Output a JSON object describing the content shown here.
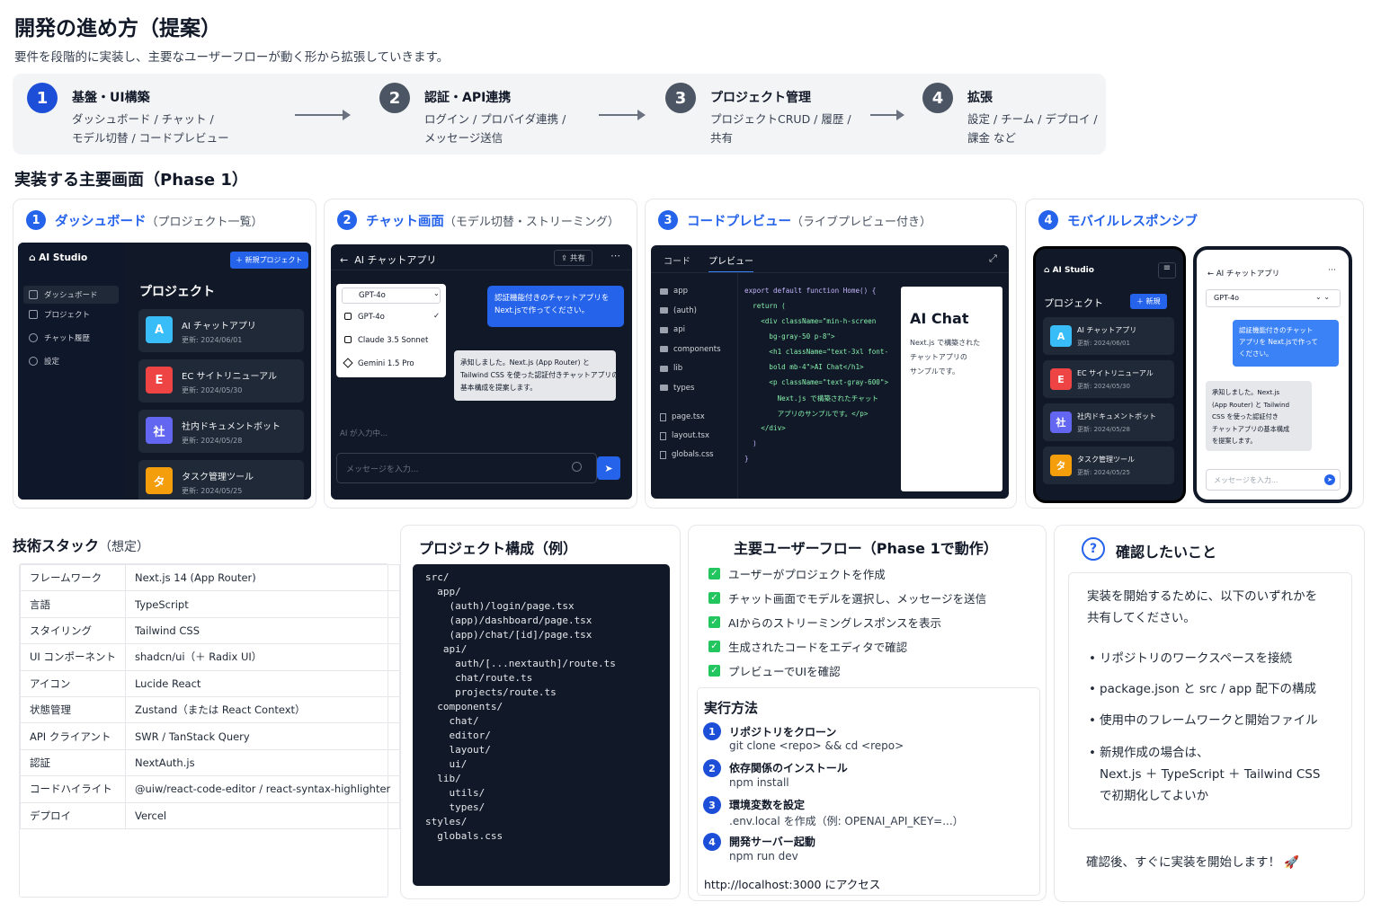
{
  "title": "開発の進め方（提案）",
  "subtitle": "要件を段階的に実装し、主要なユーザーフローが動く形から拡張していきます。",
  "steps": [
    {
      "n": "1",
      "title": "基盤・UI構築",
      "desc": "ダッシュボード / チャット /\nモデル切替 / コードプレビュー"
    },
    {
      "n": "2",
      "title": "認証・API連携",
      "desc": "ログイン / プロバイダ連携 /\nメッセージ送信"
    },
    {
      "n": "3",
      "title": "プロジェクト管理",
      "desc": "プロジェクトCRUD / 履歴 /\n共有"
    },
    {
      "n": "4",
      "title": "拡張",
      "desc": "設定 / チーム / デプロイ /\n課金 など"
    }
  ],
  "screens_heading": "実装する主要画面（Phase 1）",
  "cards": [
    {
      "n": "1",
      "title": "ダッシュボード",
      "sub": "（プロジェクト一覧）"
    },
    {
      "n": "2",
      "title": "チャット画面",
      "sub": "（モデル切替・ストリーミング）"
    },
    {
      "n": "3",
      "title": "コードプレビュー",
      "sub": "（ライブプレビュー付き）"
    },
    {
      "n": "4",
      "title": "モバイルレスポンシブ",
      "sub": ""
    }
  ],
  "dash": {
    "brand": "AI Studio",
    "new_btn": "＋ 新規プロジェクト",
    "heading": "プロジェクト",
    "nav": [
      "ダッシュボード",
      "プロジェクト",
      "チャット履歴",
      "設定"
    ],
    "projects": [
      {
        "av": "A",
        "name": "AI チャットアプリ",
        "date": "更新: 2024/06/01",
        "color": "#38bdf8"
      },
      {
        "av": "E",
        "name": "EC サイトリニューアル",
        "date": "更新: 2024/05/30",
        "color": "#ef4444"
      },
      {
        "av": "社",
        "name": "社内ドキュメントボット",
        "date": "更新: 2024/05/28",
        "color": "#6366f1"
      },
      {
        "av": "タ",
        "name": "タスク管理ツール",
        "date": "更新: 2024/05/25",
        "color": "#f59e0b"
      }
    ]
  },
  "chat": {
    "title": "AI チャットアプリ",
    "share": "共有",
    "models": [
      "GPT-4o",
      "GPT-4o",
      "Claude 3.5 Sonnet",
      "Gemini 1.5 Pro"
    ],
    "user_msg": "認証機能付きのチャットアプリを\nNext.jsで作ってください。",
    "ai_msg": "承知しました。Next.js (App Router) と\nTailwind CSS を使った認証付きチャットアプリの\n基本構成を提案します。",
    "typing": "AI が入力中...",
    "placeholder": "メッセージを入力..."
  },
  "code": {
    "tabs": [
      "コード",
      "プレビュー"
    ],
    "files": [
      "app",
      "(auth)",
      "api",
      "components",
      "lib",
      "types",
      "page.tsx",
      "layout.tsx",
      "globals.css"
    ],
    "lines": [
      "export default function Home() {",
      "  return (",
      "    <div className=\"min-h-screen",
      "      bg-gray-50 p-8\">",
      "      <h1 className=\"text-3xl font-",
      "      bold mb-4\">AI Chat</h1>",
      "      <p className=\"text-gray-600\">",
      "        Next.js で構築されたチャット",
      "        アプリのサンプルです。</p>",
      "    </div>",
      "  )",
      "}"
    ],
    "preview_title": "AI Chat",
    "preview_text": "Next.js で構築された\nチャットアプリの\nサンプルです。"
  },
  "mobile": {
    "brand": "AI Studio",
    "heading": "プロジェクト",
    "new_btn": "＋ 新規",
    "chat_title": "AI チャットアプリ",
    "model": "GPT-4o",
    "user_msg": "認証機能付きのチャット\nアプリを Next.jsで作って\nください。",
    "ai_msg": "承知しました。Next.js\n(App Router) と Tailwind\nCSS を使った認証付き\nチャットアプリの基本構成\nを提案します。",
    "placeholder": "メッセージを入力..."
  },
  "tech": {
    "heading": "技術スタック",
    "heading_sub": "（想定）",
    "rows": [
      [
        "フレームワーク",
        "Next.js 14 (App Router)"
      ],
      [
        "言語",
        "TypeScript"
      ],
      [
        "スタイリング",
        "Tailwind CSS"
      ],
      [
        "UI コンポーネント",
        "shadcn/ui（＋ Radix UI）"
      ],
      [
        "アイコン",
        "Lucide React"
      ],
      [
        "状態管理",
        "Zustand（または React Context）"
      ],
      [
        "API クライアント",
        "SWR / TanStack Query"
      ],
      [
        "認証",
        "NextAuth.js"
      ],
      [
        "コードハイライト",
        "@uiw/react-code-editor / react-syntax-highlighter"
      ],
      [
        "デプロイ",
        "Vercel"
      ]
    ]
  },
  "structure": {
    "heading": "プロジェクト構成（例）",
    "lines": [
      "src/",
      "  app/",
      "    (auth)/login/page.tsx",
      "    (app)/dashboard/page.tsx",
      "    (app)/chat/[id]/page.tsx",
      "   api/",
      "     auth/[...nextauth]/route.ts",
      "     chat/route.ts",
      "     projects/route.ts",
      "  components/",
      "    chat/",
      "    editor/",
      "    layout/",
      "    ui/",
      "  lib/",
      "    utils/",
      "    types/",
      "styles/",
      "  globals.css"
    ]
  },
  "userflow": {
    "heading": "主要ユーザーフロー（Phase 1で動作）",
    "items": [
      "ユーザーがプロジェクトを作成",
      "チャット画面でモデルを選択し、メッセージを送信",
      "AIからのストリーミングレスポンスを表示",
      "生成されたコードをエディタで確認",
      "プレビューでUIを確認"
    ]
  },
  "run": {
    "heading": "実行方法",
    "steps": [
      {
        "n": "1",
        "t": "リポジトリをクローン",
        "c": "git clone <repo> && cd <repo>"
      },
      {
        "n": "2",
        "t": "依存関係のインストール",
        "c": "npm install"
      },
      {
        "n": "3",
        "t": "環境変数を設定",
        "c": ".env.local を作成（例: OPENAI_API_KEY=...）"
      },
      {
        "n": "4",
        "t": "開発サーバー起動",
        "c": "npm run dev"
      }
    ],
    "access": "http://localhost:3000 にアクセス"
  },
  "confirm": {
    "heading": "確認したいこと",
    "intro": "実装を開始するために、以下のいずれかを\n共有してください。",
    "bullets": [
      "リポジトリのワークスペースを接続",
      "package.json と src / app 配下の構成",
      "使用中のフレームワークと開始ファイル",
      "新規作成の場合は、\nNext.js ＋ TypeScript ＋ Tailwind CSS\nで初期化してよいか"
    ],
    "footer": "確認後、すぐに実装を開始します！ 🚀"
  }
}
